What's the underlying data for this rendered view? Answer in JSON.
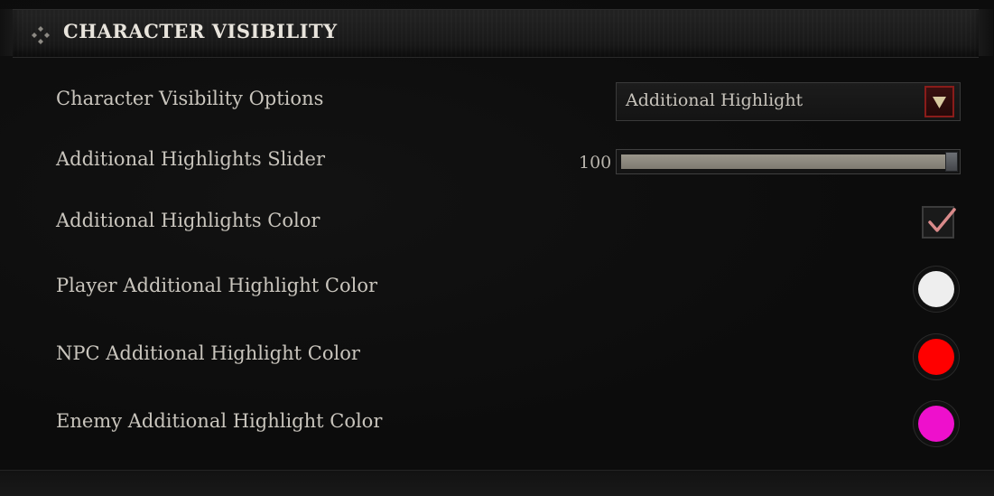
{
  "section": {
    "title": "CHARACTER VISIBILITY",
    "icon": "diamond-cluster-icon"
  },
  "settings": {
    "visibility_options": {
      "label": "Character Visibility Options",
      "value": "Additional Highlight",
      "icon": "dropdown-arrow-icon"
    },
    "highlights_slider": {
      "label": "Additional Highlights Slider",
      "value": "100",
      "fraction": 1.0
    },
    "highlights_color": {
      "label": "Additional Highlights Color",
      "checked": true
    },
    "player_color": {
      "label": "Player Additional Highlight Color",
      "color": "#eeeeee"
    },
    "npc_color": {
      "label": "NPC Additional Highlight Color",
      "color": "#ff0000"
    },
    "enemy_color": {
      "label": "Enemy Additional Highlight Color",
      "color": "#ee10cc"
    }
  },
  "colors": {
    "accent": "#8a1c1a",
    "text": "#c9c5bd",
    "title": "#e8e4dc"
  }
}
